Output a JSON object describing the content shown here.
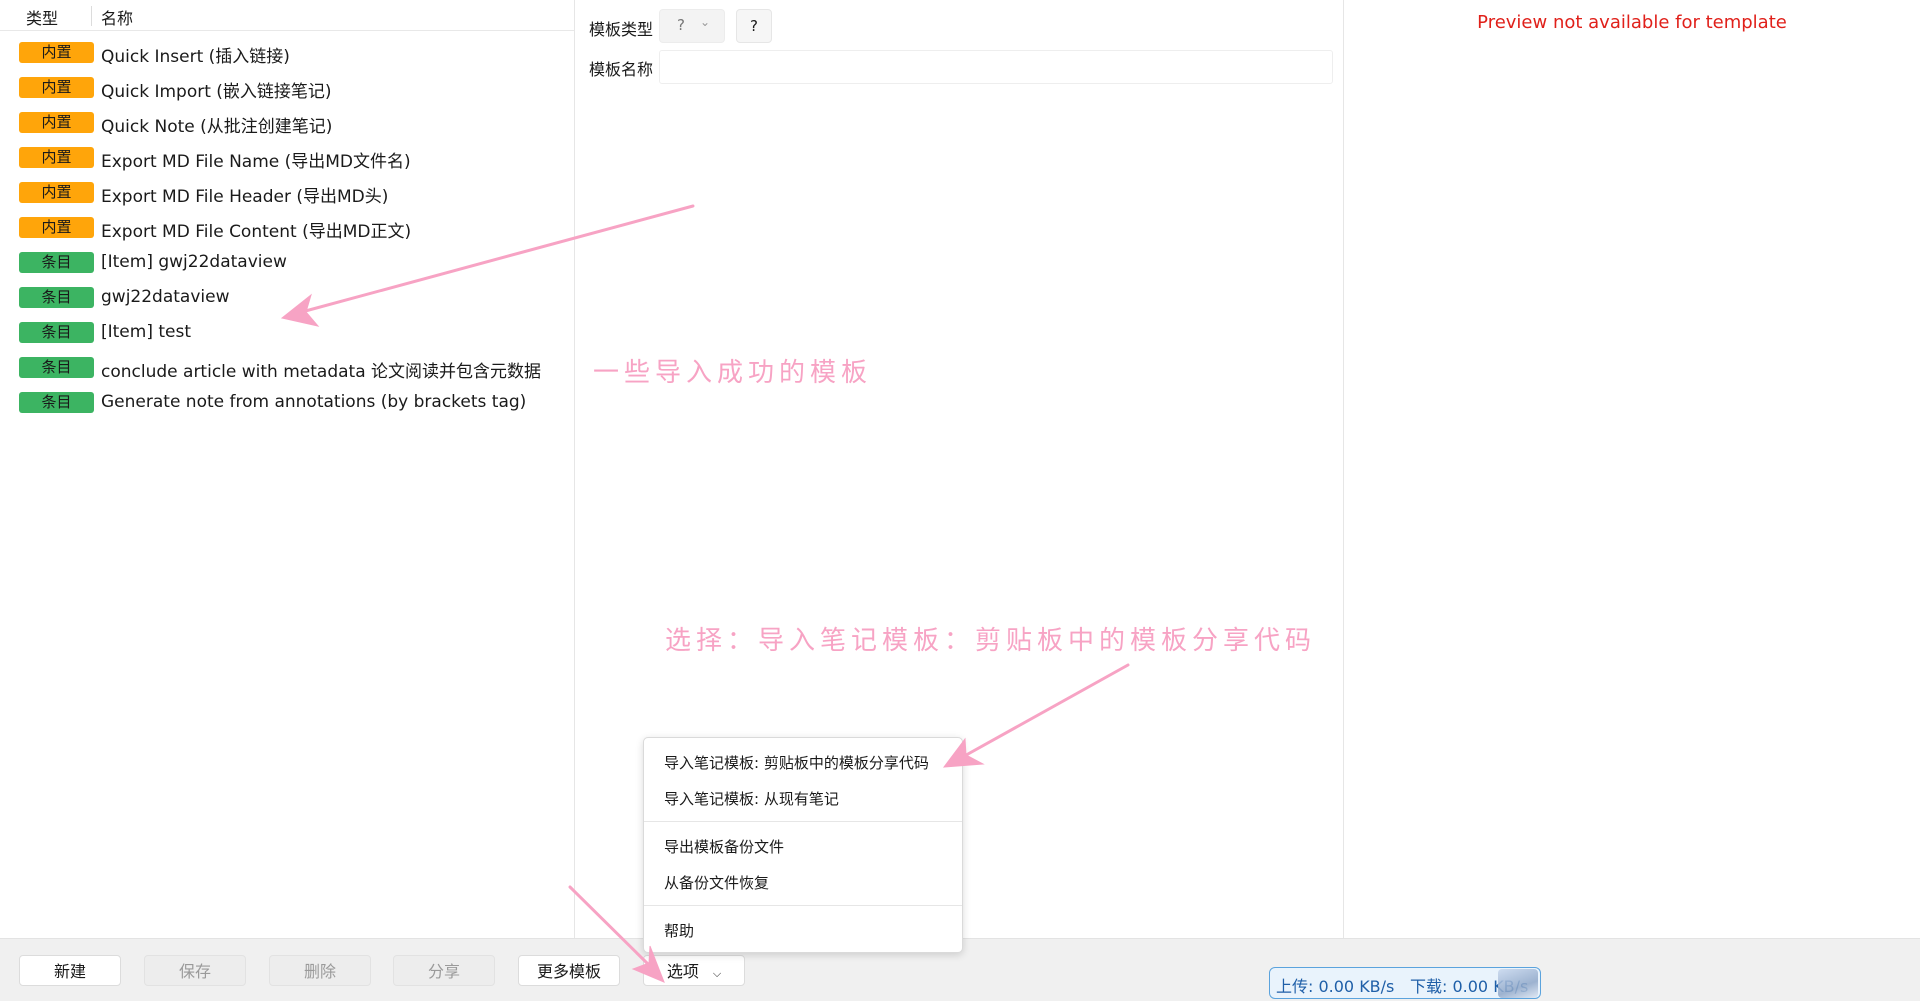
{
  "list": {
    "header": {
      "type": "类型",
      "name": "名称"
    },
    "rows": [
      {
        "badge": "内置",
        "kind": "builtin",
        "name": "Quick Insert (插入链接)"
      },
      {
        "badge": "内置",
        "kind": "builtin",
        "name": "Quick Import (嵌入链接笔记)"
      },
      {
        "badge": "内置",
        "kind": "builtin",
        "name": "Quick Note (从批注创建笔记)"
      },
      {
        "badge": "内置",
        "kind": "builtin",
        "name": "Export MD File Name (导出MD文件名)"
      },
      {
        "badge": "内置",
        "kind": "builtin",
        "name": "Export MD File Header (导出MD头)"
      },
      {
        "badge": "内置",
        "kind": "builtin",
        "name": "Export MD File Content (导出MD正文)"
      },
      {
        "badge": "条目",
        "kind": "item",
        "name": "[Item] gwj22dataview"
      },
      {
        "badge": "条目",
        "kind": "item",
        "name": "gwj22dataview"
      },
      {
        "badge": "条目",
        "kind": "item",
        "name": "[Item] test"
      },
      {
        "badge": "条目",
        "kind": "item",
        "name": "conclude article with metadata 论文阅读并包含元数据"
      },
      {
        "badge": "条目",
        "kind": "item",
        "name": "Generate note from annotations (by brackets tag)"
      }
    ]
  },
  "editor": {
    "type_label": "模板类型",
    "type_value": "?",
    "help_label": "?",
    "name_label": "模板名称",
    "name_value": ""
  },
  "preview": {
    "message": "Preview not available for template"
  },
  "footer": {
    "new_label": "新建",
    "save_label": "保存",
    "delete_label": "删除",
    "share_label": "分享",
    "more_label": "更多模板",
    "options_label": "选项"
  },
  "menu": {
    "items": [
      "导入笔记模板: 剪贴板中的模板分享代码",
      "导入笔记模板: 从现有笔记",
      "导出模板备份文件",
      "从备份文件恢复",
      "帮助"
    ]
  },
  "annotations": {
    "note1": "一些导入成功的模板",
    "note2": "选择：导入笔记模板：剪贴板中的模板分享代码"
  },
  "network": {
    "upload": "上传: 0.00 KB/s",
    "download": "下载: 0.00 KB/s"
  },
  "colors": {
    "builtin_badge": "#ffa50a",
    "item_badge": "#3cb462",
    "preview_error": "#e0201a",
    "annotation": "#f7a3c4"
  }
}
